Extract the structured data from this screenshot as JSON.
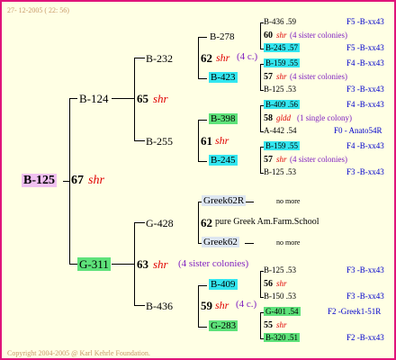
{
  "header": {
    "date": "27- 12-2005 ( 22: 56)"
  },
  "footer": {
    "copyright": "Copyright 2004-2005 @ Karl Kehrle Foundation."
  },
  "root": {
    "id": "B-125",
    "num": "67",
    "tag": "shr"
  },
  "gen1": {
    "top": {
      "id": "B-124",
      "num": "65",
      "tag": "shr"
    },
    "bottom": {
      "id": "G-311",
      "num": "63",
      "tag": "shr",
      "note": "(4 sister colonies)"
    }
  },
  "gen2": {
    "b232": {
      "id": "B-232",
      "num": "62",
      "tag": "shr",
      "note": "(4 c.)"
    },
    "b255": {
      "id": "B-255",
      "num": "61",
      "tag": "shr"
    },
    "g428": {
      "id": "G-428",
      "num": "62",
      "tag": "pure Greek Am.Farm.School"
    },
    "b436": {
      "id": "B-436",
      "num": "59",
      "tag": "shr",
      "note": "(4 c.)"
    }
  },
  "gen3": {
    "b278": {
      "id": "B-278",
      "num": "60",
      "tag": "shr",
      "note": "(4 sister colonies)"
    },
    "b423": {
      "id": "B-423",
      "num": "57",
      "tag": "shr",
      "note": "(4 sister colonies)"
    },
    "b398": {
      "id": "B-398",
      "num": "58",
      "tag": "gldd",
      "note": "(1 single colony)"
    },
    "b245": {
      "id": "B-245",
      "num": "57",
      "tag": "shr",
      "note": "(4 sister colonies)"
    },
    "greek62r": {
      "id": "Greek62R",
      "more": "no more"
    },
    "greek62": {
      "id": "Greek62",
      "more": "no more"
    },
    "b409": {
      "id": "B-409",
      "num": "56",
      "tag": "shr"
    },
    "g283": {
      "id": "G-283",
      "num": "55",
      "tag": "shr"
    }
  },
  "gen4": [
    {
      "id": "B-436",
      "num": ".59",
      "code": "F5 -B-xx43"
    },
    {
      "id": "B-245",
      "num": ".57",
      "code": "F5 -B-xx43"
    },
    {
      "id": "B-159",
      "num": ".55",
      "code": "F4 -B-xx43"
    },
    {
      "id": "B-125",
      "num": ".53",
      "code": "F3 -B-xx43"
    },
    {
      "id": "B-409",
      "num": ".56",
      "code": "F4 -B-xx43"
    },
    {
      "id": "A-442",
      "num": ".54",
      "code": "F0 - Anato54R"
    },
    {
      "id": "B-159",
      "num": ".55",
      "code": "F4 -B-xx43"
    },
    {
      "id": "B-125",
      "num": ".53",
      "code": "F3 -B-xx43"
    },
    {
      "id": "B-125",
      "num": ".53",
      "code": "F3 -B-xx43"
    },
    {
      "id": "B-150",
      "num": ".53",
      "code": "F3 -B-xx43"
    },
    {
      "id": "G-401",
      "num": ".54",
      "code": "F2 -Greek1-51R"
    },
    {
      "id": "B-320",
      "num": ".51",
      "code": "F2 -B-xx43"
    }
  ]
}
